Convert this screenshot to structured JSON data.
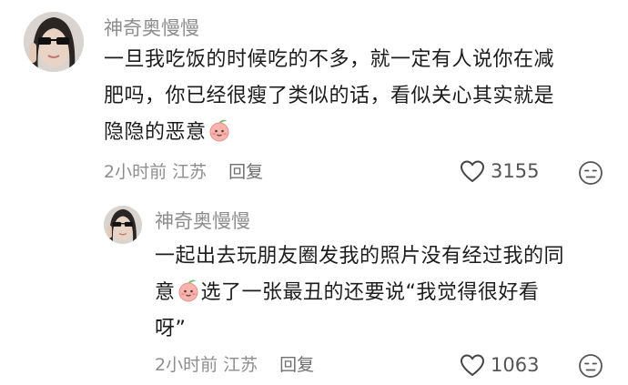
{
  "comments": [
    {
      "username": "神奇奥慢慢",
      "text_lines": [
        "一旦我吃饭的时候吃的不多，就一定有人说你在减",
        "肥吗，你已经很瘦了类似的话，看似关心其实就是",
        "隐隐的恶意"
      ],
      "emoji": "peach-face-emoji",
      "time": "2小时前",
      "location": "江苏",
      "reply_label": "回复",
      "like_count": "3155"
    },
    {
      "username": "神奇奥慢慢",
      "text_lines": [
        "一起出去玩朋友圈发我的照片没有经过我的同",
        "意",
        "选了一张最丑的还要说“我觉得很好看",
        "呀”"
      ],
      "emoji": "peach-face-emoji",
      "time": "2小时前",
      "location": "江苏",
      "reply_label": "回复",
      "like_count": "1063"
    }
  ],
  "colors": {
    "username": "#8d8d8d",
    "text": "#1c1c1c",
    "meta": "#8e8e8e",
    "emoji_fill": "#f6a6a6"
  }
}
